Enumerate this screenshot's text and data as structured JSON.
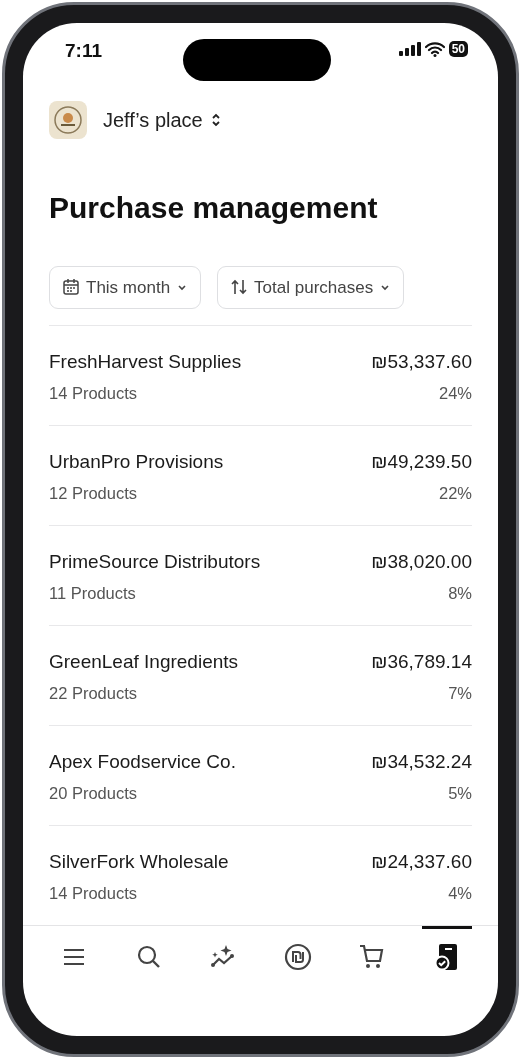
{
  "status_bar": {
    "time": "7:11",
    "battery": "50"
  },
  "workspace": {
    "name": "Jeff’s place"
  },
  "title": "Purchase management",
  "filters": [
    {
      "kind": "calendar",
      "label": "This month"
    },
    {
      "kind": "sort",
      "label": "Total purchases"
    }
  ],
  "suppliers": [
    {
      "name": "FreshHarvest Supplies",
      "products": "14 Products",
      "amount": "₪53,337.60",
      "share": "24%"
    },
    {
      "name": "UrbanPro Provisions",
      "products": "12 Products",
      "amount": "₪49,239.50",
      "share": "22%"
    },
    {
      "name": "PrimeSource Distributors",
      "products": "11 Products",
      "amount": "₪38,020.00",
      "share": "8%"
    },
    {
      "name": "GreenLeaf Ingredients",
      "products": "22 Products",
      "amount": "₪36,789.14",
      "share": "7%"
    },
    {
      "name": "Apex Foodservice Co.",
      "products": "20 Products",
      "amount": "₪34,532.24",
      "share": "5%"
    },
    {
      "name": "SilverFork Wholesale",
      "products": "14 Products",
      "amount": "₪24,337.60",
      "share": "4%"
    }
  ],
  "tab_bar": [
    {
      "kind": "menu",
      "selected": false
    },
    {
      "kind": "search",
      "selected": false
    },
    {
      "kind": "insights",
      "selected": false
    },
    {
      "kind": "currency",
      "selected": false
    },
    {
      "kind": "cart",
      "selected": false
    },
    {
      "kind": "purchases",
      "selected": true
    }
  ]
}
